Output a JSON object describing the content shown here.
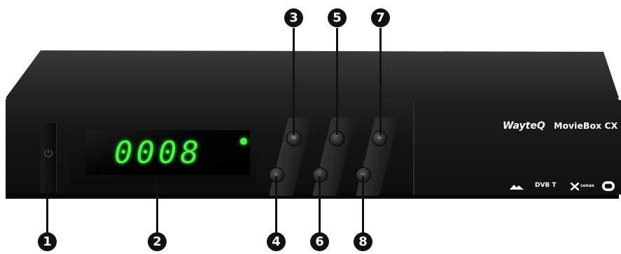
{
  "device": {
    "brand": "WayteQ",
    "model": "MovieBox CX",
    "display_value": "0008",
    "logos": [
      "dvb",
      "DVB T",
      "conax",
      "dolby"
    ]
  },
  "callouts": [
    "1",
    "2",
    "3",
    "4",
    "5",
    "6",
    "7",
    "8"
  ],
  "colors": {
    "display_green": "#3cff3c",
    "body_black": "#141414",
    "callout_black": "#111111"
  }
}
